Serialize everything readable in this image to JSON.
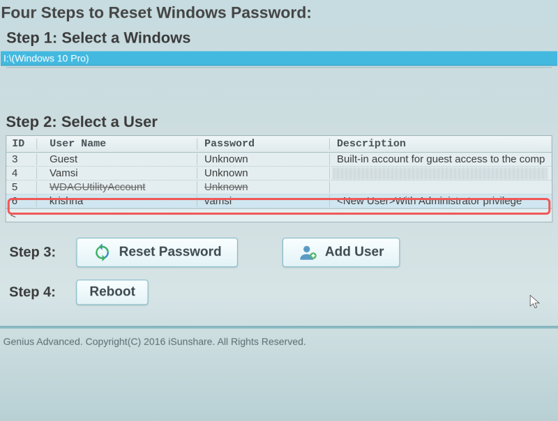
{
  "heading": "Four Steps to Reset Windows Password:",
  "step1": {
    "title": "Step 1: Select a Windows",
    "os_entry": "I:\\(Windows 10 Pro)"
  },
  "step2": {
    "title": "Step 2: Select a User",
    "headers": {
      "id": "ID",
      "user": "User Name",
      "pass": "Password",
      "desc": "Description"
    },
    "rows": [
      {
        "id": "3",
        "user": "Guest",
        "pass": "Unknown",
        "desc": "Built-in account for guest access to the comp"
      },
      {
        "id": "4",
        "user": "Vamsi",
        "pass": "Unknown",
        "desc": ""
      },
      {
        "id": "5",
        "user": "WDAGUtilityAccount",
        "pass": "Unknown",
        "desc": ""
      },
      {
        "id": "6",
        "user": "krishna",
        "pass": "vamsi",
        "desc": "<New User>With Administrator privilege"
      }
    ],
    "scroll_hint": "<"
  },
  "step3": {
    "label": "Step 3:",
    "reset_btn": "Reset Password",
    "adduser_btn": "Add User"
  },
  "step4": {
    "label": "Step 4:",
    "reboot_btn": "Reboot"
  },
  "footer": "Genius Advanced. Copyright(C) 2016 iSunshare. All Rights Reserved."
}
